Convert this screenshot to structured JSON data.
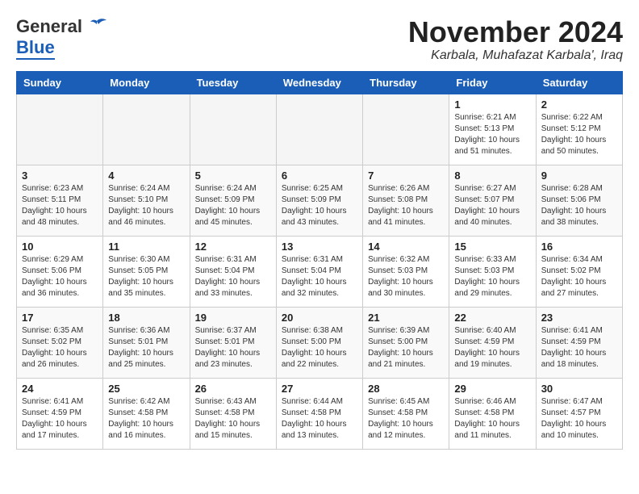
{
  "logo": {
    "general": "General",
    "blue": "Blue"
  },
  "header": {
    "month": "November 2024",
    "location": "Karbala, Muhafazat Karbala', Iraq"
  },
  "weekdays": [
    "Sunday",
    "Monday",
    "Tuesday",
    "Wednesday",
    "Thursday",
    "Friday",
    "Saturday"
  ],
  "weeks": [
    [
      {
        "day": "",
        "empty": true
      },
      {
        "day": "",
        "empty": true
      },
      {
        "day": "",
        "empty": true
      },
      {
        "day": "",
        "empty": true
      },
      {
        "day": "",
        "empty": true
      },
      {
        "day": "1",
        "sunrise": "Sunrise: 6:21 AM",
        "sunset": "Sunset: 5:13 PM",
        "daylight": "Daylight: 10 hours and 51 minutes."
      },
      {
        "day": "2",
        "sunrise": "Sunrise: 6:22 AM",
        "sunset": "Sunset: 5:12 PM",
        "daylight": "Daylight: 10 hours and 50 minutes."
      }
    ],
    [
      {
        "day": "3",
        "sunrise": "Sunrise: 6:23 AM",
        "sunset": "Sunset: 5:11 PM",
        "daylight": "Daylight: 10 hours and 48 minutes."
      },
      {
        "day": "4",
        "sunrise": "Sunrise: 6:24 AM",
        "sunset": "Sunset: 5:10 PM",
        "daylight": "Daylight: 10 hours and 46 minutes."
      },
      {
        "day": "5",
        "sunrise": "Sunrise: 6:24 AM",
        "sunset": "Sunset: 5:09 PM",
        "daylight": "Daylight: 10 hours and 45 minutes."
      },
      {
        "day": "6",
        "sunrise": "Sunrise: 6:25 AM",
        "sunset": "Sunset: 5:09 PM",
        "daylight": "Daylight: 10 hours and 43 minutes."
      },
      {
        "day": "7",
        "sunrise": "Sunrise: 6:26 AM",
        "sunset": "Sunset: 5:08 PM",
        "daylight": "Daylight: 10 hours and 41 minutes."
      },
      {
        "day": "8",
        "sunrise": "Sunrise: 6:27 AM",
        "sunset": "Sunset: 5:07 PM",
        "daylight": "Daylight: 10 hours and 40 minutes."
      },
      {
        "day": "9",
        "sunrise": "Sunrise: 6:28 AM",
        "sunset": "Sunset: 5:06 PM",
        "daylight": "Daylight: 10 hours and 38 minutes."
      }
    ],
    [
      {
        "day": "10",
        "sunrise": "Sunrise: 6:29 AM",
        "sunset": "Sunset: 5:06 PM",
        "daylight": "Daylight: 10 hours and 36 minutes."
      },
      {
        "day": "11",
        "sunrise": "Sunrise: 6:30 AM",
        "sunset": "Sunset: 5:05 PM",
        "daylight": "Daylight: 10 hours and 35 minutes."
      },
      {
        "day": "12",
        "sunrise": "Sunrise: 6:31 AM",
        "sunset": "Sunset: 5:04 PM",
        "daylight": "Daylight: 10 hours and 33 minutes."
      },
      {
        "day": "13",
        "sunrise": "Sunrise: 6:31 AM",
        "sunset": "Sunset: 5:04 PM",
        "daylight": "Daylight: 10 hours and 32 minutes."
      },
      {
        "day": "14",
        "sunrise": "Sunrise: 6:32 AM",
        "sunset": "Sunset: 5:03 PM",
        "daylight": "Daylight: 10 hours and 30 minutes."
      },
      {
        "day": "15",
        "sunrise": "Sunrise: 6:33 AM",
        "sunset": "Sunset: 5:03 PM",
        "daylight": "Daylight: 10 hours and 29 minutes."
      },
      {
        "day": "16",
        "sunrise": "Sunrise: 6:34 AM",
        "sunset": "Sunset: 5:02 PM",
        "daylight": "Daylight: 10 hours and 27 minutes."
      }
    ],
    [
      {
        "day": "17",
        "sunrise": "Sunrise: 6:35 AM",
        "sunset": "Sunset: 5:02 PM",
        "daylight": "Daylight: 10 hours and 26 minutes."
      },
      {
        "day": "18",
        "sunrise": "Sunrise: 6:36 AM",
        "sunset": "Sunset: 5:01 PM",
        "daylight": "Daylight: 10 hours and 25 minutes."
      },
      {
        "day": "19",
        "sunrise": "Sunrise: 6:37 AM",
        "sunset": "Sunset: 5:01 PM",
        "daylight": "Daylight: 10 hours and 23 minutes."
      },
      {
        "day": "20",
        "sunrise": "Sunrise: 6:38 AM",
        "sunset": "Sunset: 5:00 PM",
        "daylight": "Daylight: 10 hours and 22 minutes."
      },
      {
        "day": "21",
        "sunrise": "Sunrise: 6:39 AM",
        "sunset": "Sunset: 5:00 PM",
        "daylight": "Daylight: 10 hours and 21 minutes."
      },
      {
        "day": "22",
        "sunrise": "Sunrise: 6:40 AM",
        "sunset": "Sunset: 4:59 PM",
        "daylight": "Daylight: 10 hours and 19 minutes."
      },
      {
        "day": "23",
        "sunrise": "Sunrise: 6:41 AM",
        "sunset": "Sunset: 4:59 PM",
        "daylight": "Daylight: 10 hours and 18 minutes."
      }
    ],
    [
      {
        "day": "24",
        "sunrise": "Sunrise: 6:41 AM",
        "sunset": "Sunset: 4:59 PM",
        "daylight": "Daylight: 10 hours and 17 minutes."
      },
      {
        "day": "25",
        "sunrise": "Sunrise: 6:42 AM",
        "sunset": "Sunset: 4:58 PM",
        "daylight": "Daylight: 10 hours and 16 minutes."
      },
      {
        "day": "26",
        "sunrise": "Sunrise: 6:43 AM",
        "sunset": "Sunset: 4:58 PM",
        "daylight": "Daylight: 10 hours and 15 minutes."
      },
      {
        "day": "27",
        "sunrise": "Sunrise: 6:44 AM",
        "sunset": "Sunset: 4:58 PM",
        "daylight": "Daylight: 10 hours and 13 minutes."
      },
      {
        "day": "28",
        "sunrise": "Sunrise: 6:45 AM",
        "sunset": "Sunset: 4:58 PM",
        "daylight": "Daylight: 10 hours and 12 minutes."
      },
      {
        "day": "29",
        "sunrise": "Sunrise: 6:46 AM",
        "sunset": "Sunset: 4:58 PM",
        "daylight": "Daylight: 10 hours and 11 minutes."
      },
      {
        "day": "30",
        "sunrise": "Sunrise: 6:47 AM",
        "sunset": "Sunset: 4:57 PM",
        "daylight": "Daylight: 10 hours and 10 minutes."
      }
    ]
  ]
}
